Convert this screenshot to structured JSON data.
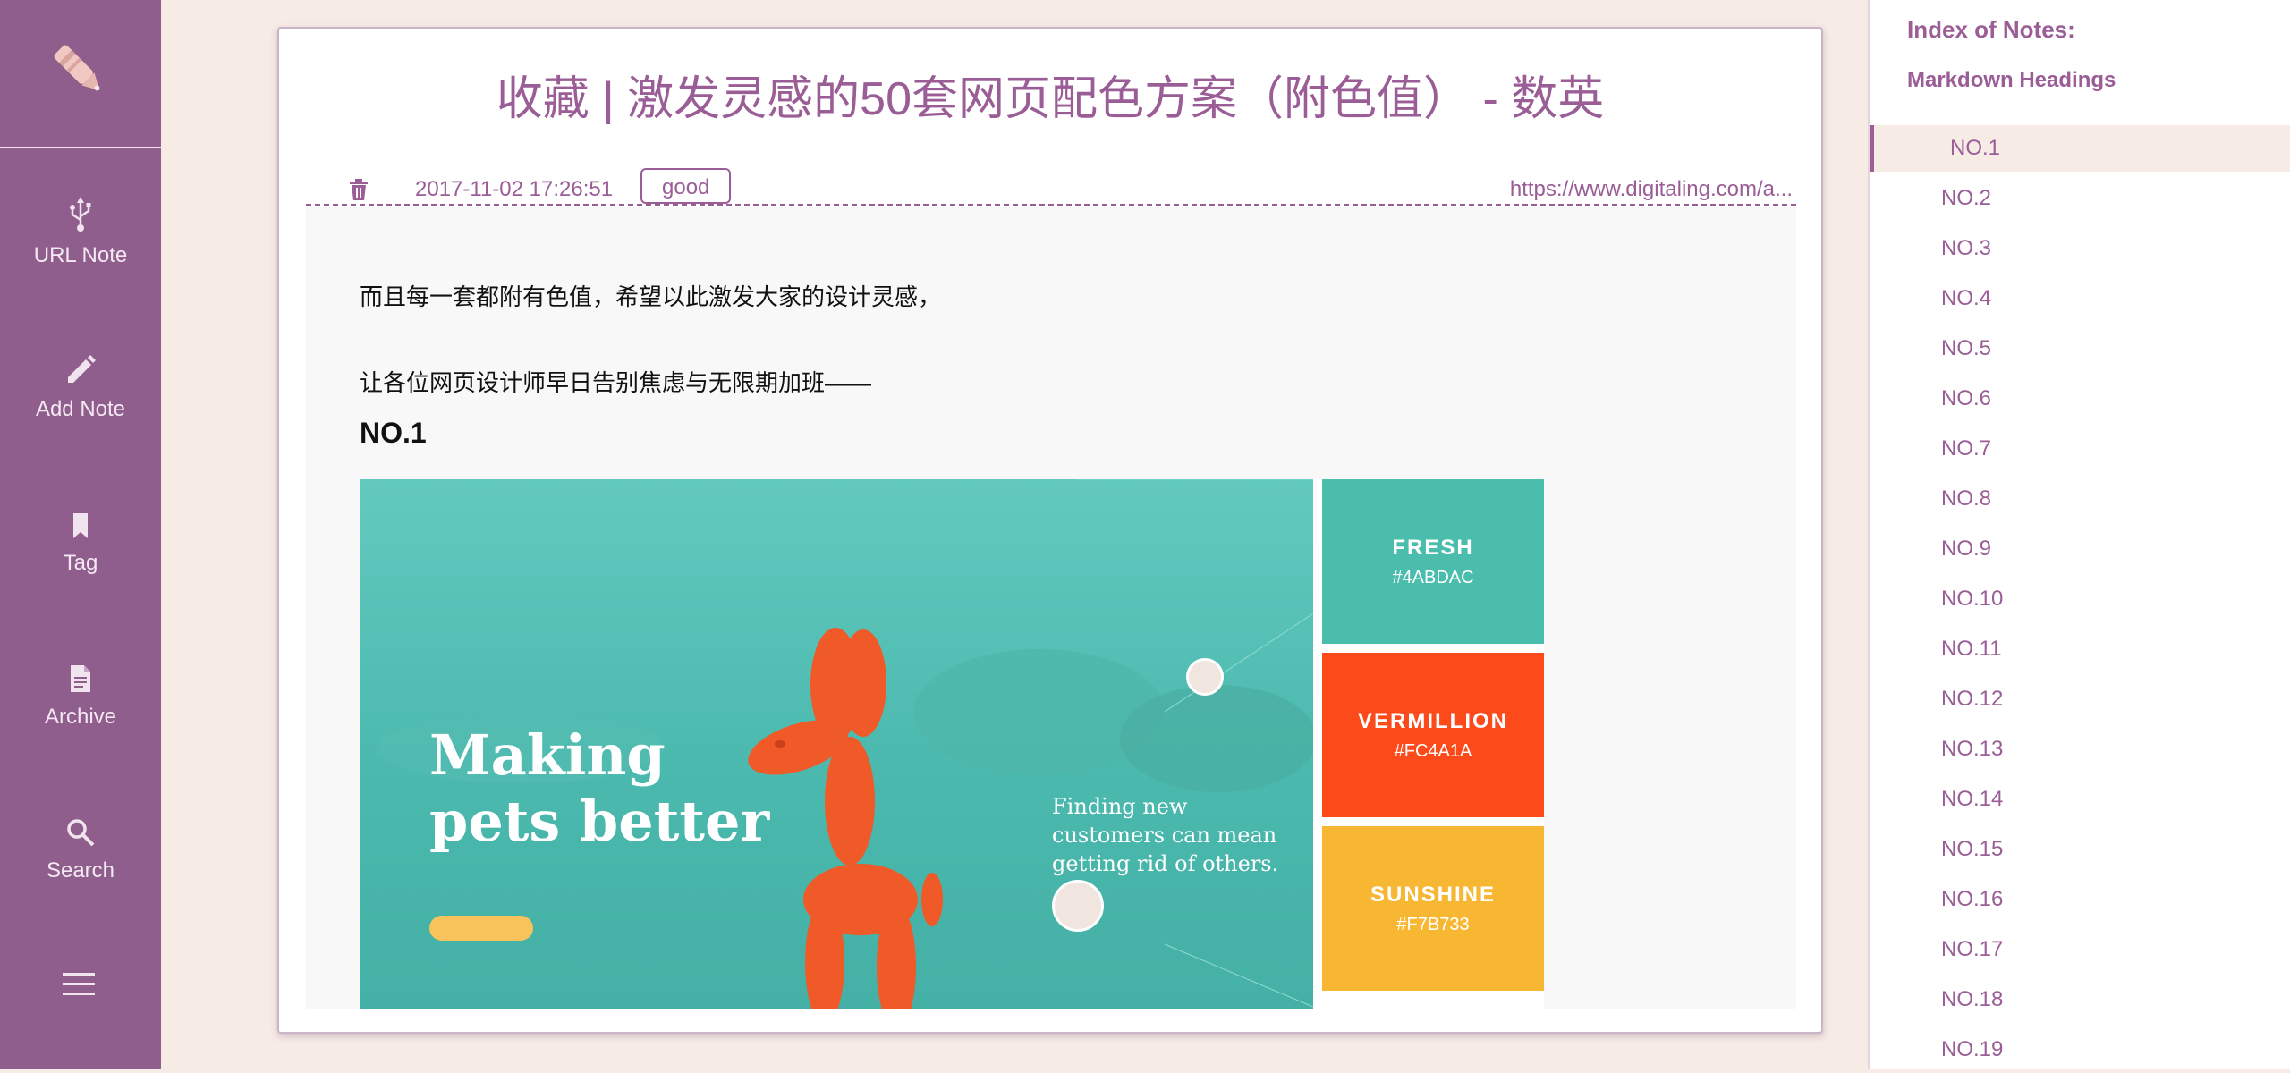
{
  "sidebar": {
    "logo_icon": "pen-icon",
    "items": [
      {
        "label": "URL Note",
        "icon": "usb-icon"
      },
      {
        "label": "Add Note",
        "icon": "pencil-icon"
      },
      {
        "label": "Tag",
        "icon": "bookmark-icon"
      },
      {
        "label": "Archive",
        "icon": "document-icon"
      },
      {
        "label": "Search",
        "icon": "search-icon"
      }
    ],
    "menu_icon": "menu-icon"
  },
  "note": {
    "title": "收藏 | 激发灵感的50套网页配色方案（附色值） - 数英",
    "date": "2017-11-02 17:26:51",
    "tag": "good",
    "url": "https://www.digitaling.com/a...",
    "paragraphs": [
      "而且每一套都附有色值，希望以此激发大家的设计灵感，",
      "让各位网页设计师早日告别焦虑与无限期加班——"
    ],
    "heading": "NO.1",
    "image": {
      "hero_line1": "Making",
      "hero_line2": "pets better",
      "story_line1": "Finding new",
      "story_line2": "customers can mean",
      "story_line3": "getting rid of others.",
      "swatches": [
        {
          "name": "FRESH",
          "hex": "#4ABDAC",
          "color": "#4ABDAC"
        },
        {
          "name": "VERMILLION",
          "hex": "#FC4A1A",
          "color": "#FC4A1A"
        },
        {
          "name": "SUNSHINE",
          "hex": "#F7B733",
          "color": "#F7B733"
        }
      ]
    }
  },
  "index": {
    "title": "Index of Notes:",
    "subtitle": "Markdown Headings",
    "items": [
      "NO.1",
      "NO.2",
      "NO.3",
      "NO.4",
      "NO.5",
      "NO.6",
      "NO.7",
      "NO.8",
      "NO.9",
      "NO.10",
      "NO.11",
      "NO.12",
      "NO.13",
      "NO.14",
      "NO.15",
      "NO.16",
      "NO.17",
      "NO.18",
      "NO.19"
    ]
  },
  "colors": {
    "sidebar_bg": "#8f5e8c",
    "accent": "#9a5d96",
    "page_bg": "#f7ebe6"
  }
}
